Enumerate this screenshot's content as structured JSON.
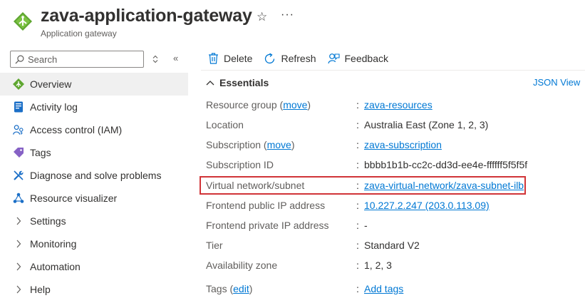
{
  "header": {
    "title": "zava-application-gateway",
    "subtitle": "Application gateway",
    "star_glyph": "☆",
    "more_glyph": "···"
  },
  "search": {
    "placeholder": "Search",
    "expand_glyph": "⬦",
    "collapse_glyph": "«"
  },
  "sidebar": {
    "items": [
      {
        "label": "Overview",
        "icon": "app-gateway-icon",
        "active": true
      },
      {
        "label": "Activity log",
        "icon": "activity-log-icon"
      },
      {
        "label": "Access control (IAM)",
        "icon": "iam-icon"
      },
      {
        "label": "Tags",
        "icon": "tag-icon"
      },
      {
        "label": "Diagnose and solve problems",
        "icon": "wrench-icon"
      },
      {
        "label": "Resource visualizer",
        "icon": "visualizer-icon"
      },
      {
        "label": "Settings",
        "icon": "chevron-right-icon"
      },
      {
        "label": "Monitoring",
        "icon": "chevron-right-icon"
      },
      {
        "label": "Automation",
        "icon": "chevron-right-icon"
      },
      {
        "label": "Help",
        "icon": "chevron-right-icon"
      }
    ]
  },
  "toolbar": {
    "delete_label": "Delete",
    "refresh_label": "Refresh",
    "feedback_label": "Feedback"
  },
  "essentials": {
    "title": "Essentials",
    "json_view": "JSON View",
    "rows": [
      {
        "label": "Resource group",
        "label_link": "move",
        "value": "zava-resources",
        "value_is_link": true
      },
      {
        "label": "Location",
        "value": "Australia East (Zone 1, 2, 3)"
      },
      {
        "label": "Subscription",
        "label_link": "move",
        "value": "zava-subscription",
        "value_is_link": true
      },
      {
        "label": "Subscription ID",
        "value": "bbbb1b1b-cc2c-dd3d-ee4e-ffffff5f5f5f"
      },
      {
        "label": "Virtual network/subnet",
        "value": "zava-virtual-network/zava-subnet-ilb",
        "value_is_link": true,
        "highlighted": true
      },
      {
        "label": "Frontend public IP address",
        "value": "10.227.2.247 (203.0.113.09)",
        "value_is_link": true
      },
      {
        "label": "Frontend private IP address",
        "value": "-"
      },
      {
        "label": "Tier",
        "value": "Standard V2"
      },
      {
        "label": "Availability zone",
        "value": "1, 2, 3"
      },
      {
        "label": "Tags",
        "label_link": "edit",
        "value": "Add tags",
        "value_is_link": true
      }
    ]
  },
  "colors": {
    "link": "#0078d4",
    "highlight": "#d13438",
    "active_bg": "#f0f0f0"
  }
}
